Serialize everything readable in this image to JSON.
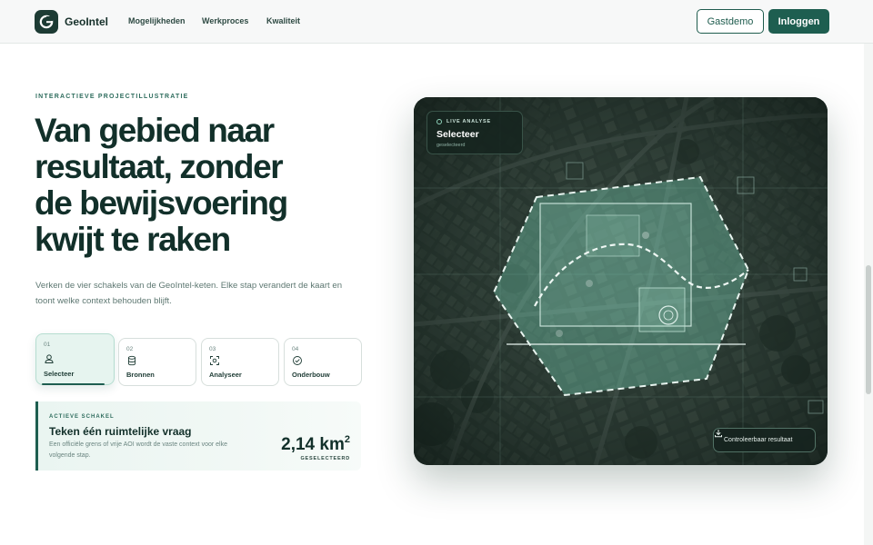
{
  "header": {
    "brand": "GeoIntel",
    "nav": [
      "Mogelijkheden",
      "Werkproces",
      "Kwaliteit"
    ],
    "demo_label": "Gastdemo",
    "login_label": "Inloggen"
  },
  "hero": {
    "eyebrow": "INTERACTIEVE PROJECTILLUSTRATIE",
    "title_lines": [
      "Van gebied naar",
      "resultaat, zonder",
      "de bewijsvoering",
      "kwijt te raken"
    ],
    "description": "Verken de vier schakels van de GeoIntel-keten. Elke stap verandert de kaart en toont welke context behouden blijft."
  },
  "steps": [
    {
      "num": "01",
      "label": "Selecteer",
      "icon": "user-pin-icon",
      "active": true
    },
    {
      "num": "02",
      "label": "Bronnen",
      "icon": "database-icon",
      "active": false
    },
    {
      "num": "03",
      "label": "Analyseer",
      "icon": "scan-icon",
      "active": false
    },
    {
      "num": "04",
      "label": "Onderbouw",
      "icon": "check-circle-icon",
      "active": false
    }
  ],
  "active_step": {
    "eyebrow": "ACTIEVE SCHAKEL",
    "title": "Teken één ruimtelijke vraag",
    "text": "Een officiële grens of vrije AOI wordt de vaste context voor elke volgende stap.",
    "metric_value": "2,14 km",
    "metric_sup": "2",
    "metric_unit": "GESELECTEERD"
  },
  "map": {
    "live_eyebrow": "LIVE ANALYSE",
    "live_title": "Selecteer",
    "live_sub": "geselecteerd",
    "result_label": "Controleerbaar resultaat"
  },
  "colors": {
    "brand": "#1e5e50",
    "ink": "#12302a",
    "map_bg": "#26362f",
    "polygon": "#8fd3bb"
  }
}
